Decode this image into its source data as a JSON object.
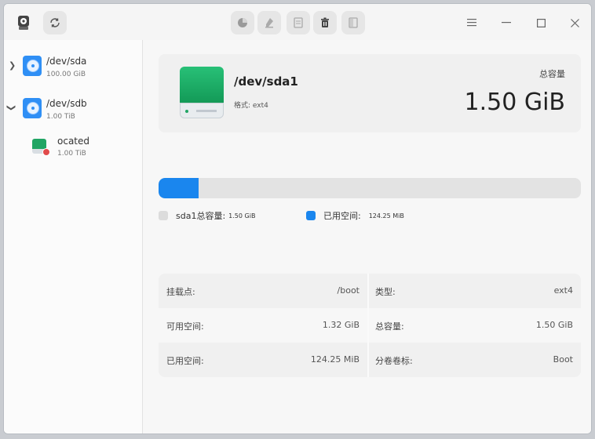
{
  "toolbar": {
    "left_icons": [
      "disk-utility-icon",
      "refresh-icon"
    ],
    "center_icons": [
      "partition-icon",
      "wipe-icon",
      "format-icon",
      "delete-icon",
      "unmount-icon"
    ],
    "window_controls": [
      "menu-icon",
      "minimize-icon",
      "maximize-icon",
      "close-icon"
    ]
  },
  "sidebar": {
    "disks": [
      {
        "name": "/dev/sda",
        "size": "100.00 GiB",
        "expanded": false
      },
      {
        "name": "/dev/sdb",
        "size": "1.00 TiB",
        "expanded": true
      }
    ],
    "partitions": [
      {
        "name": "ocated",
        "size": "1.00 TiB"
      }
    ]
  },
  "main": {
    "title": "/dev/sda1",
    "format_text": "格式: ext4",
    "capacity_label": "总容量",
    "capacity_value": "1.50 GiB",
    "usage_fraction": 0.094,
    "legend": {
      "total_label": "sda1总容量:",
      "total_value": "1.50 GiB",
      "used_label": "已用空间:",
      "used_value": "124.25 MiB"
    },
    "details": [
      {
        "left_label": "挂载点:",
        "left_value": "/boot",
        "right_label": "类型:",
        "right_value": "ext4"
      },
      {
        "left_label": "可用空间:",
        "left_value": "1.32 GiB",
        "right_label": "总容量:",
        "right_value": "1.50 GiB"
      },
      {
        "left_label": "已用空间:",
        "left_value": "124.25 MiB",
        "right_label": "分卷卷标:",
        "right_value": "Boot"
      }
    ]
  },
  "colors": {
    "accent": "#1a86ee",
    "partition_green": "#21a564",
    "bar_background": "#e3e3e3",
    "unused_swatch": "#dcdcdc"
  }
}
